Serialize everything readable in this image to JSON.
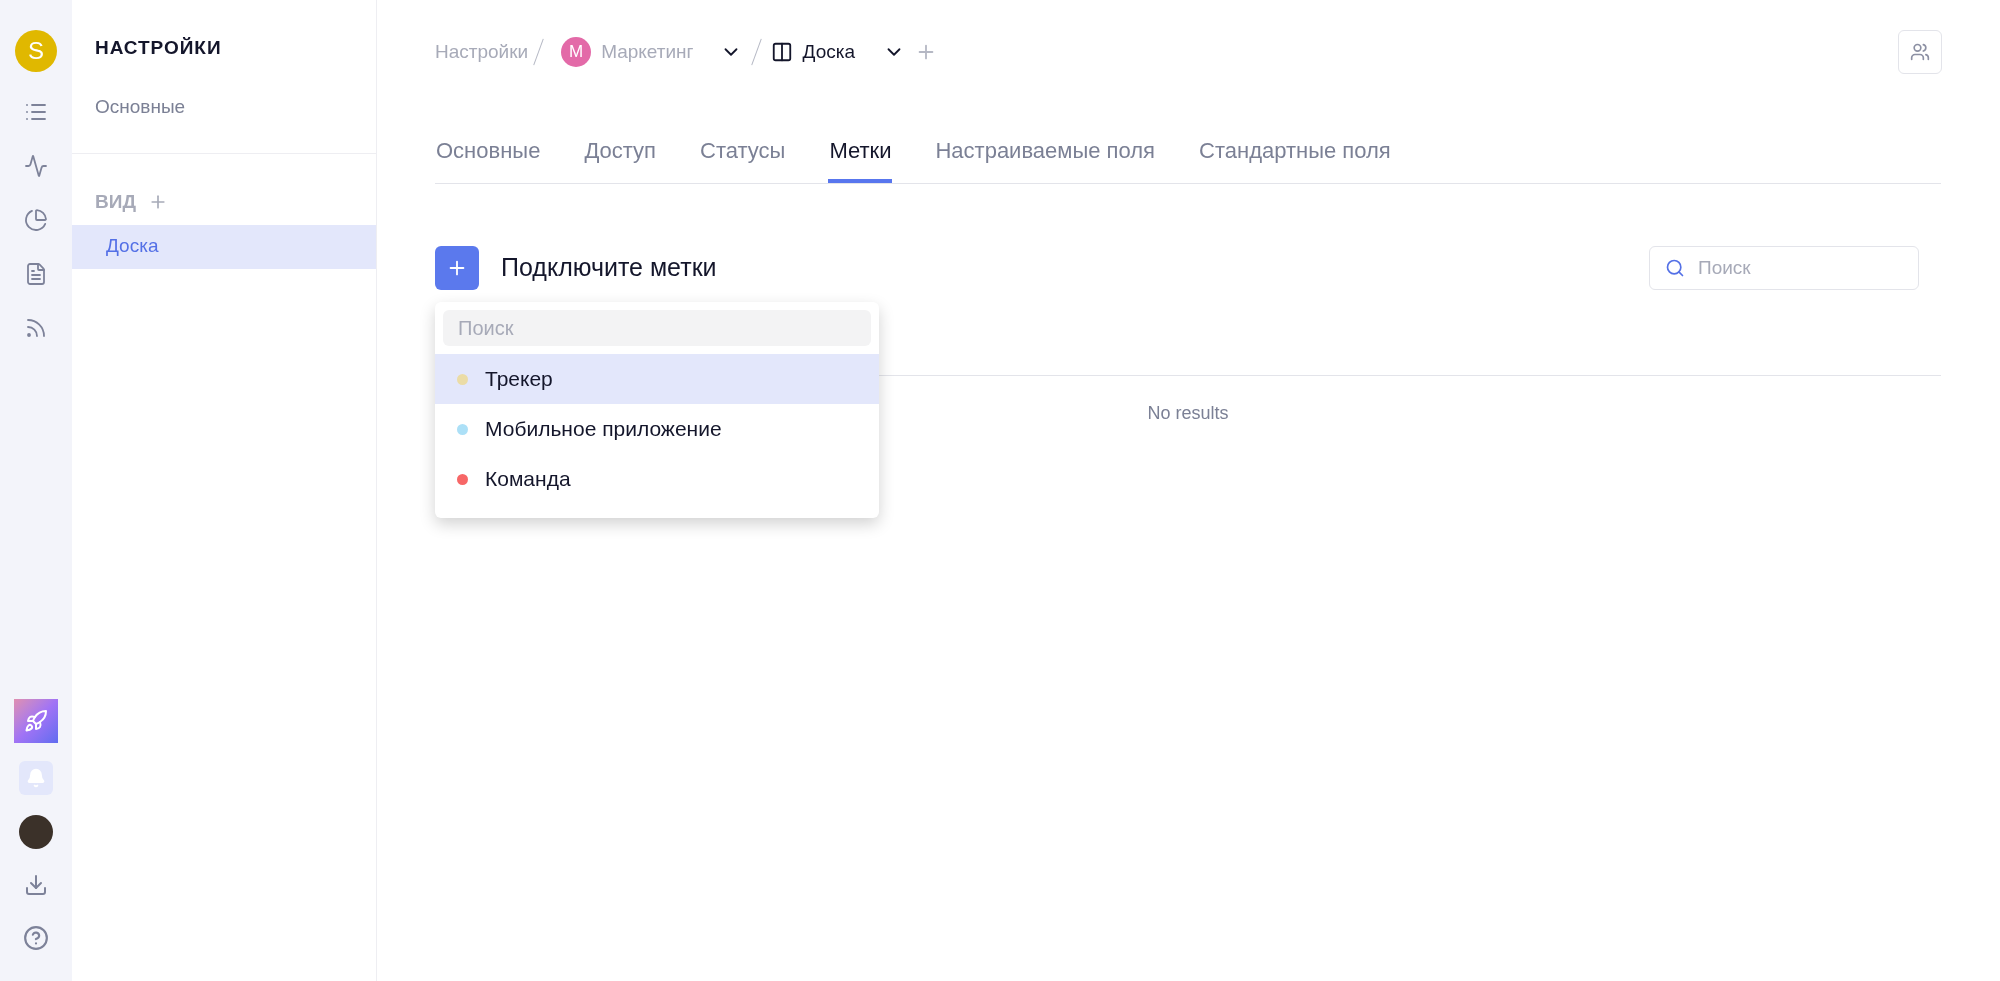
{
  "rail": {
    "workspace_initial": "S"
  },
  "sidebar": {
    "title": "НАСТРОЙКИ",
    "general": "Основные",
    "section": "ВИД",
    "items": [
      {
        "label": "Доска",
        "selected": true
      }
    ]
  },
  "breadcrumb": {
    "root": "Настройки",
    "project": {
      "initial": "М",
      "label": "Маркетинг"
    },
    "view": "Доска"
  },
  "tabs": [
    {
      "label": "Основные",
      "selected": false
    },
    {
      "label": "Доступ",
      "selected": false
    },
    {
      "label": "Статусы",
      "selected": false
    },
    {
      "label": "Метки",
      "selected": true
    },
    {
      "label": "Настраиваемые поля",
      "selected": false
    },
    {
      "label": "Стандартные поля",
      "selected": false
    }
  ],
  "heading": "Подключите метки",
  "search": {
    "placeholder": "Поиск"
  },
  "dropdown": {
    "placeholder": "Поиск",
    "items": [
      {
        "label": "Трекер",
        "color": "#ebdca6",
        "selected": true
      },
      {
        "label": "Мобильное приложение",
        "color": "#ace0f7",
        "selected": false
      },
      {
        "label": "Команда",
        "color": "#f76767",
        "selected": false
      }
    ]
  },
  "empty_text": "No results"
}
